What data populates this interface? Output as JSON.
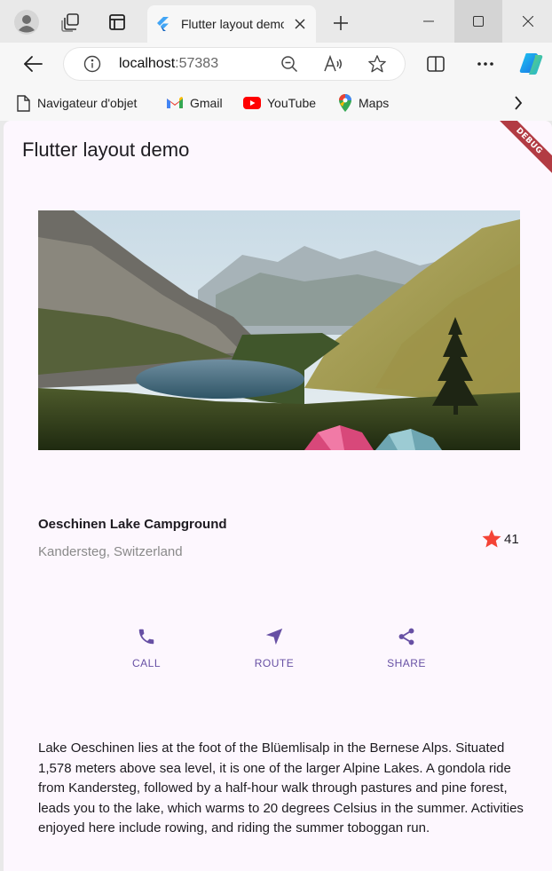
{
  "browser": {
    "tab": {
      "title": "Flutter layout demo"
    },
    "address": {
      "host": "localhost",
      "port": ":57383"
    },
    "bookmarks": [
      {
        "label": "Navigateur d'objet",
        "icon": "page-icon"
      },
      {
        "label": "Gmail",
        "icon": "gmail-icon"
      },
      {
        "label": "YouTube",
        "icon": "youtube-icon"
      },
      {
        "label": "Maps",
        "icon": "maps-icon"
      }
    ]
  },
  "app": {
    "title": "Flutter layout demo",
    "debug_banner": "DEBUG",
    "place": {
      "name": "Oeschinen Lake Campground",
      "location": "Kandersteg, Switzerland",
      "rating": "41"
    },
    "actions": [
      {
        "label": "CALL",
        "icon": "phone-icon"
      },
      {
        "label": "ROUTE",
        "icon": "navigation-arrow-icon"
      },
      {
        "label": "SHARE",
        "icon": "share-icon"
      }
    ],
    "description": "Lake Oeschinen lies at the foot of the Blüemlisalp in the Bernese Alps. Situated 1,578 meters above sea level, it is one of the larger Alpine Lakes. A gondola ride from Kandersteg, followed by a half-hour walk through pastures and pine forest, leads you to the lake, which warms to 20 degrees Celsius in the summer. Activities enjoyed here include rowing, and riding the summer toboggan run."
  },
  "colors": {
    "accent": "#6750a4",
    "star": "#f44336",
    "background": "#fdf7fe",
    "debug": "#b23b43"
  }
}
